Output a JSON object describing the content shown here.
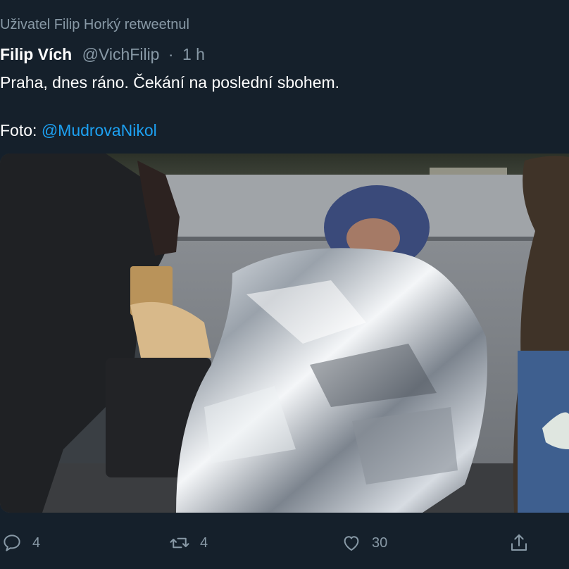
{
  "retweet_context": "Uživatel Filip Horký retweetnul",
  "author": {
    "name": "Filip Vích",
    "handle": "@VichFilip",
    "separator": "·",
    "time": "1 h"
  },
  "text": {
    "line1": "Praha, dnes ráno. Čekání na poslední sbohem.",
    "line2_prefix": "Foto: ",
    "line2_mention": "@MudrovaNikol"
  },
  "actions": {
    "reply_count": "4",
    "retweet_count": "4",
    "like_count": "30",
    "icons": [
      "reply-icon",
      "retweet-icon",
      "like-icon",
      "share-icon"
    ]
  },
  "colors": {
    "background": "#15202b",
    "secondary_text": "#8899a6",
    "link": "#1da1f2"
  }
}
